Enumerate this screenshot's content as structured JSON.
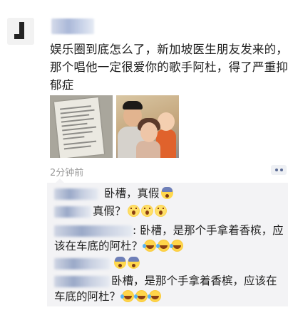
{
  "post": {
    "text": "娱乐圈到底怎么了，新加坡医生朋友发来的，那个唱他一定很爱你的歌手阿杜，得了严重抑郁症",
    "time": "2分钟前",
    "photos": [
      "document-photo",
      "family-photo"
    ]
  },
  "comments": [
    {
      "text": "卧槽，真假",
      "emojis": [
        "fear"
      ]
    },
    {
      "text": "真假？",
      "emojis": [
        "wow",
        "wow",
        "wow"
      ]
    },
    {
      "text": ": 卧槽，是那个手拿着香槟，应",
      "text2": "该在车底的阿杜？",
      "emojis": [
        "lol",
        "lol",
        "lol"
      ]
    },
    {
      "text": "",
      "emojis": [
        "fear",
        "fear"
      ]
    },
    {
      "text": "卧槽，是那个手拿着香槟，应该在",
      "text2": "车底的阿杜？",
      "emojis": [
        "lol",
        "lol",
        "lol"
      ]
    }
  ],
  "icons": {
    "more": "more-dots-icon",
    "emoji_fear": "fear-emoji-icon",
    "emoji_wow": "surprised-emoji-icon",
    "emoji_lol": "laugh-cry-emoji-icon"
  },
  "colors": {
    "comment_bg": "#f3f3f5",
    "time_text": "#9b9b9b",
    "more_dots": "#5b6b94"
  }
}
